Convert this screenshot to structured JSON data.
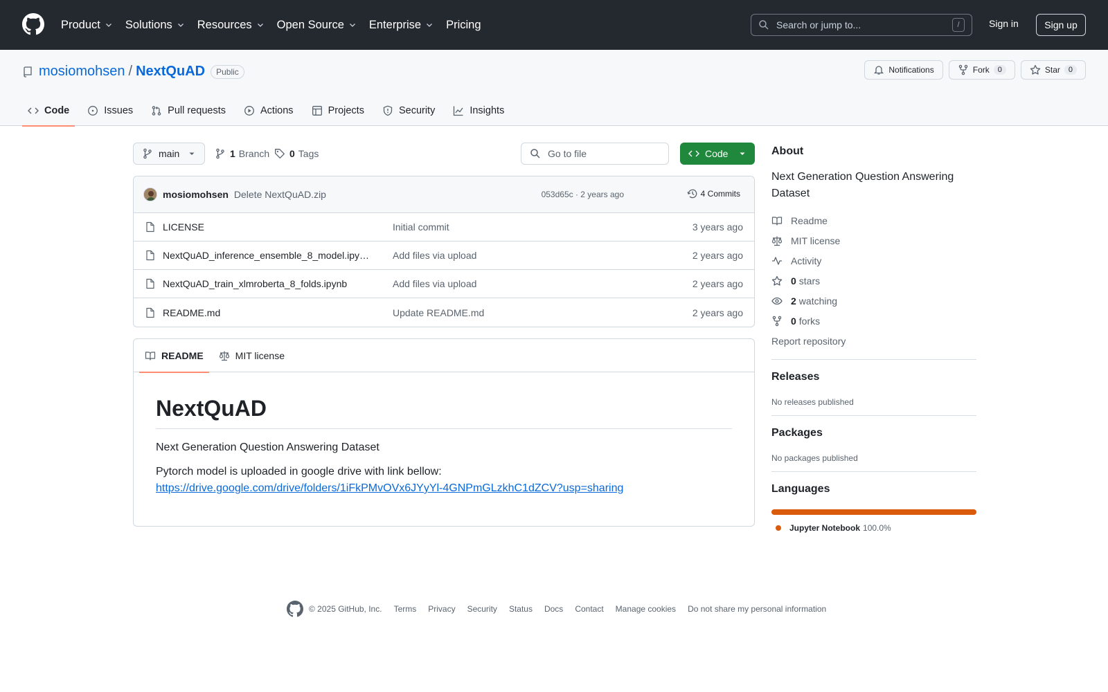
{
  "header": {
    "nav": [
      {
        "label": "Product",
        "dropdown": true
      },
      {
        "label": "Solutions",
        "dropdown": true
      },
      {
        "label": "Resources",
        "dropdown": true
      },
      {
        "label": "Open Source",
        "dropdown": true
      },
      {
        "label": "Enterprise",
        "dropdown": true
      },
      {
        "label": "Pricing",
        "dropdown": false
      }
    ],
    "search_placeholder": "Search or jump to...",
    "search_shortcut": "/",
    "sign_in": "Sign in",
    "sign_up": "Sign up"
  },
  "repo": {
    "owner": "mosiomohsen",
    "separator": "/",
    "name": "NextQuAD",
    "visibility": "Public",
    "actions": {
      "notifications": "Notifications",
      "fork": "Fork",
      "fork_count": "0",
      "star": "Star",
      "star_count": "0"
    },
    "tabs": [
      "Code",
      "Issues",
      "Pull requests",
      "Actions",
      "Projects",
      "Security",
      "Insights"
    ],
    "active_tab": "Code"
  },
  "toolbar": {
    "branch": "main",
    "branch_count": "1",
    "branch_label": "Branch",
    "tag_count": "0",
    "tag_label": "Tags",
    "go_to_file": "Go to file",
    "code_button": "Code"
  },
  "latest_commit": {
    "author": "mosiomohsen",
    "message": "Delete NextQuAD.zip",
    "meta": "053d65c · 2 years ago",
    "commits_label": "4 Commits"
  },
  "files": [
    {
      "name": "LICENSE",
      "message": "Initial commit",
      "age": "3 years ago"
    },
    {
      "name": "NextQuAD_inference_ensemble_8_model.ipy…",
      "message": "Add files via upload",
      "age": "2 years ago"
    },
    {
      "name": "NextQuAD_train_xlmroberta_8_folds.ipynb",
      "message": "Add files via upload",
      "age": "2 years ago"
    },
    {
      "name": "README.md",
      "message": "Update README.md",
      "age": "2 years ago"
    }
  ],
  "readme": {
    "tabs": [
      "README",
      "MIT license"
    ],
    "heading": "NextQuAD",
    "paragraph1": "Next Generation Question Answering Dataset",
    "paragraph2": "Pytorch model is uploaded in google drive with link bellow:",
    "link": "https://drive.google.com/drive/folders/1iFkPMvOVx6JYyYl-4GNPmGLzkhC1dZCV?usp=sharing"
  },
  "about": {
    "title": "About",
    "description": "Next Generation Question Answering Dataset",
    "readme": "Readme",
    "license": "MIT license",
    "activity": "Activity",
    "stars_count": "0",
    "stars_label": "stars",
    "watching_count": "2",
    "watching_label": "watching",
    "forks_count": "0",
    "forks_label": "forks",
    "report": "Report repository"
  },
  "releases": {
    "title": "Releases",
    "text": "No releases published"
  },
  "packages": {
    "title": "Packages",
    "text": "No packages published"
  },
  "languages": {
    "title": "Languages",
    "items": [
      {
        "name": "Jupyter Notebook",
        "percent": "100.0%",
        "color": "#da5b0b",
        "fraction": 1.0
      }
    ]
  },
  "footer": {
    "copyright": "© 2025 GitHub, Inc.",
    "links": [
      "Terms",
      "Privacy",
      "Security",
      "Status",
      "Docs",
      "Contact",
      "Manage cookies",
      "Do not share my personal information"
    ]
  },
  "colors": {
    "header_bg": "#24292f",
    "link": "#0969da",
    "primary_button": "#1f883d",
    "active_tab_underline": "#fd8c73"
  }
}
